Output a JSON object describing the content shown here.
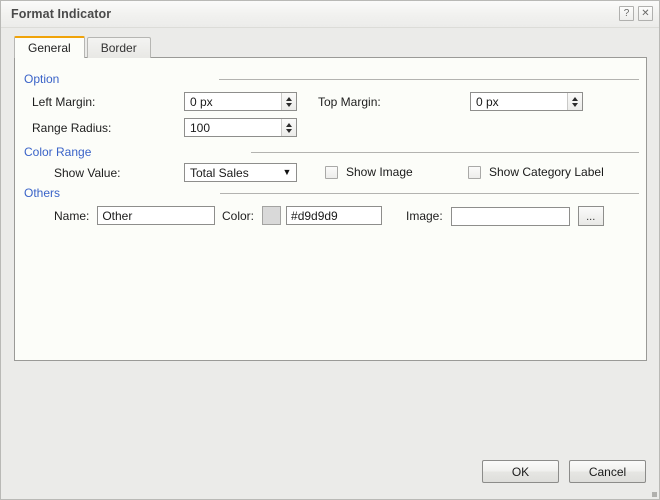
{
  "window": {
    "title": "Format Indicator",
    "help_button": "?",
    "close_button": "✕"
  },
  "tabs": [
    {
      "label": "General",
      "active": true
    },
    {
      "label": "Border",
      "active": false
    }
  ],
  "sections": {
    "option": {
      "label": "Option"
    },
    "color_range": {
      "label": "Color Range"
    },
    "others": {
      "label": "Others"
    }
  },
  "fields": {
    "left_margin": {
      "label": "Left Margin:",
      "value": "0 px"
    },
    "top_margin": {
      "label": "Top Margin:",
      "value": "0 px"
    },
    "range_radius": {
      "label": "Range Radius:",
      "value": "100"
    },
    "show_value": {
      "label": "Show Value:",
      "value": "Total Sales",
      "caret": "▼"
    },
    "show_image": {
      "label": "Show Image",
      "checked": false
    },
    "show_category_label": {
      "label": "Show Category Label",
      "checked": false
    },
    "name": {
      "label": "Name:",
      "value": "Other"
    },
    "color": {
      "label": "Color:",
      "value": "#d9d9d9",
      "swatch": "#d9d9d9"
    },
    "image": {
      "label": "Image:",
      "value": "",
      "browse_label": "..."
    }
  },
  "footer": {
    "ok_label": "OK",
    "cancel_label": "Cancel"
  },
  "colors": {
    "accent_tab": "#f0a30a",
    "section_label": "#3a63c8",
    "dialog_bg": "#ebebe9",
    "panel_bg": "#fcfdf9"
  }
}
